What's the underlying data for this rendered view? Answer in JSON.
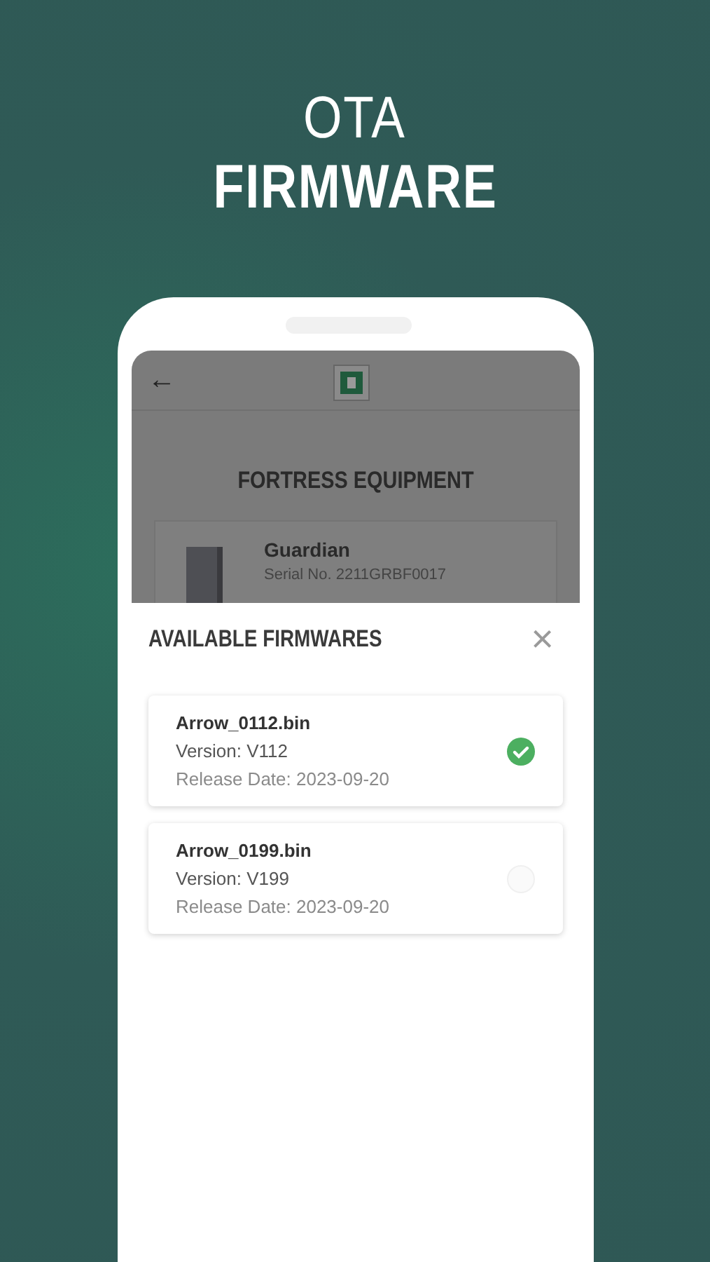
{
  "headline": {
    "line_1": "OTA",
    "line_2": "FIRMWARE"
  },
  "app_header": {
    "back": "←"
  },
  "page_title": "FORTRESS EQUIPMENT",
  "device": {
    "name": "Guardian",
    "serial": "Serial No. 2211GRBF0017"
  },
  "sheet": {
    "title": "AVAILABLE FIRMWARES",
    "close": "×",
    "firmwares": [
      {
        "file": "Arrow_0112.bin",
        "version": "Version: V112",
        "release_date": "Release Date: 2023-09-20",
        "selected": true
      },
      {
        "file": "Arrow_0199.bin",
        "version": "Version: V199",
        "release_date": "Release Date: 2023-09-20",
        "selected": false
      }
    ]
  }
}
